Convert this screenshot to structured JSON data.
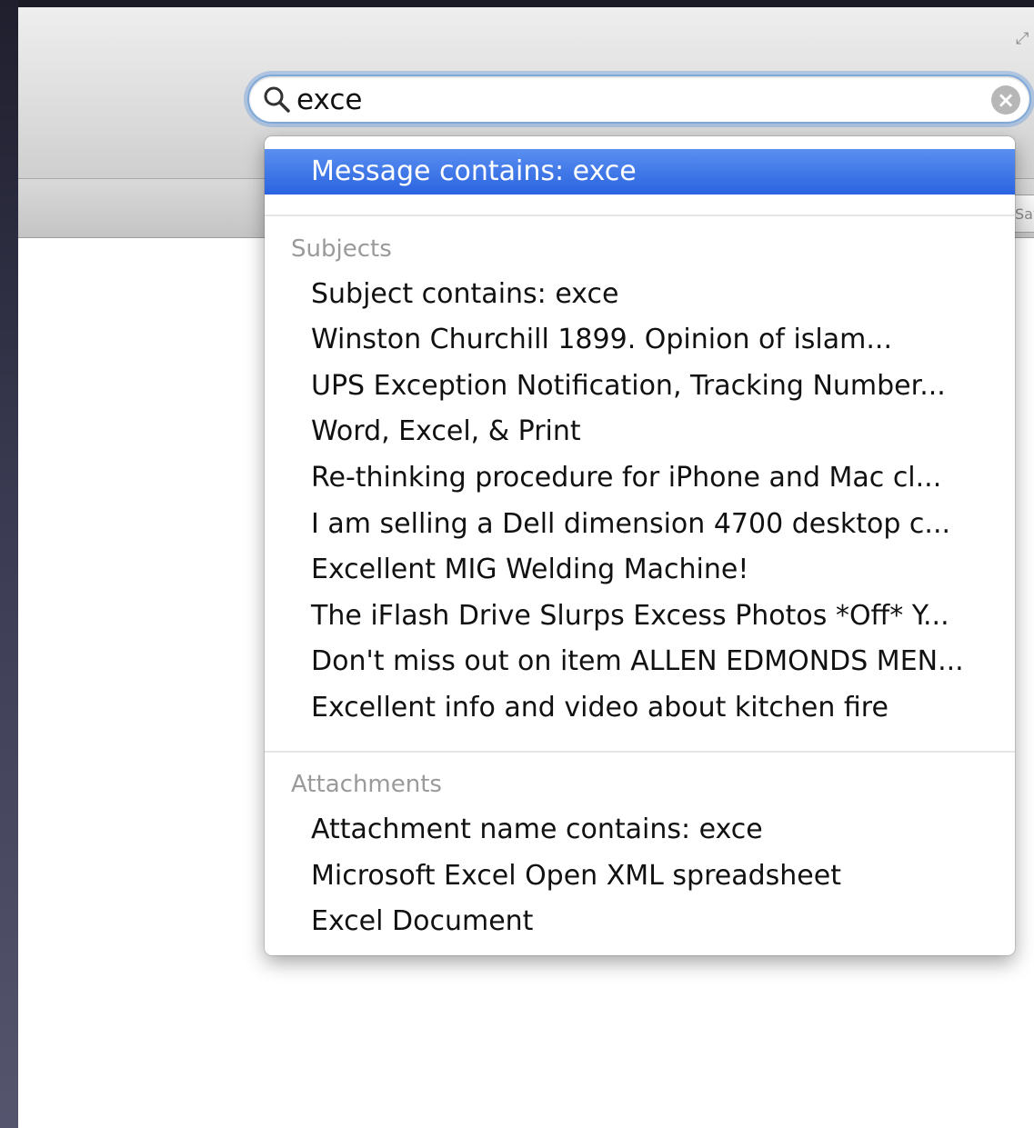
{
  "search": {
    "query": "exce"
  },
  "toolbar": {
    "save_label": "Save"
  },
  "dropdown": {
    "top_suggestion": "Message contains: exce",
    "sections": [
      {
        "heading": "Subjects",
        "items": [
          "Subject contains: exce",
          "Winston Churchill 1899. Opinion of islam...",
          "UPS Exception Notification, Tracking Number...",
          "Word, Excel, & Print",
          "Re-thinking procedure for iPhone and Mac cl...",
          "I am selling a Dell dimension 4700 desktop c...",
          "Excellent MIG Welding Machine!",
          "The iFlash Drive Slurps Excess Photos *Off* Y...",
          "Don't miss out on item ALLEN EDMONDS MEN...",
          "Excellent info and video about kitchen fire"
        ]
      },
      {
        "heading": "Attachments",
        "items": [
          "Attachment name contains: exce",
          "Microsoft Excel Open XML spreadsheet",
          "Excel Document"
        ]
      }
    ]
  },
  "colors": {
    "highlight": "#2a63e0",
    "focus_ring": "#7fa9d8"
  }
}
